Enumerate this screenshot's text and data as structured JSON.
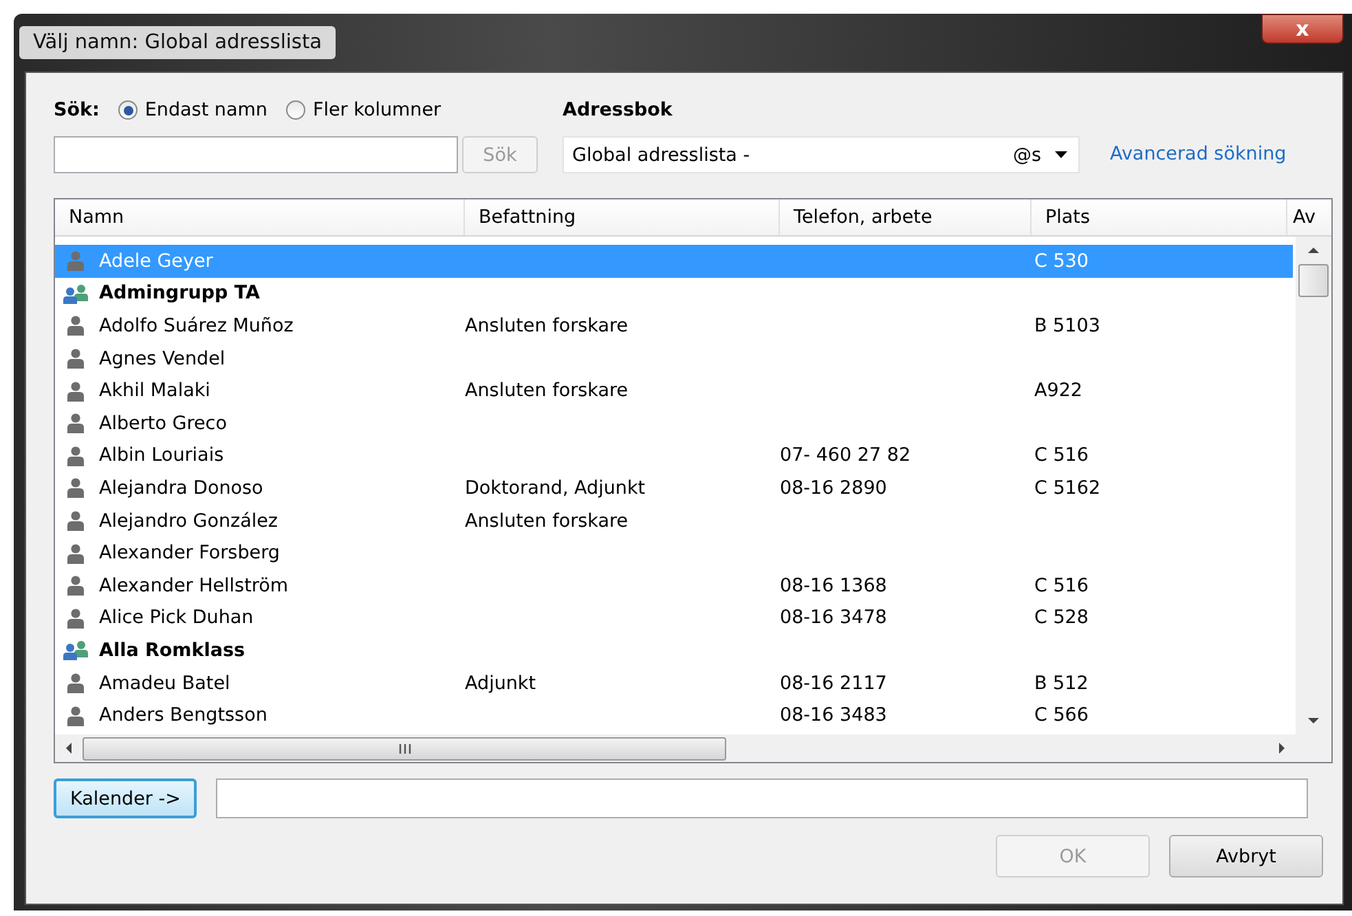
{
  "window": {
    "title": "Välj namn: Global adresslista",
    "close": "x"
  },
  "search": {
    "label": "Sök:",
    "options": [
      {
        "label": "Endast namn",
        "selected": true
      },
      {
        "label": "Fler kolumner",
        "selected": false
      }
    ],
    "button": "Sök",
    "button_disabled": true
  },
  "address_book": {
    "label": "Adressbok",
    "value": "Global adresslista -",
    "suffix": "@s",
    "advanced_link": "Avancerad sökning"
  },
  "table": {
    "columns": [
      "Namn",
      "Befattning",
      "Telefon, arbete",
      "Plats",
      "Av"
    ],
    "rows": [
      {
        "kind": "user",
        "name": "Adele Geyer",
        "title": "",
        "phone": "",
        "place": "C 530",
        "selected": true
      },
      {
        "kind": "group",
        "name": "Admingrupp TA",
        "title": "",
        "phone": "",
        "place": "",
        "selected": false
      },
      {
        "kind": "user",
        "name": "Adolfo Suárez Muñoz",
        "title": "Ansluten forskare",
        "phone": "",
        "place": "B 5103",
        "selected": false
      },
      {
        "kind": "user",
        "name": "Agnes Vendel",
        "title": "",
        "phone": "",
        "place": "",
        "selected": false
      },
      {
        "kind": "user",
        "name": "Akhil Malaki",
        "title": "Ansluten forskare",
        "phone": "",
        "place": "A922",
        "selected": false
      },
      {
        "kind": "user",
        "name": "Alberto Greco",
        "title": "",
        "phone": "",
        "place": "",
        "selected": false
      },
      {
        "kind": "user",
        "name": "Albin Louriais",
        "title": "",
        "phone": "07- 460 27 82",
        "place": "C 516",
        "selected": false
      },
      {
        "kind": "user",
        "name": "Alejandra Donoso",
        "title": "Doktorand, Adjunkt",
        "phone": "08-16 2890",
        "place": "C 5162",
        "selected": false
      },
      {
        "kind": "user",
        "name": "Alejandro González",
        "title": "Ansluten forskare",
        "phone": "",
        "place": "",
        "selected": false
      },
      {
        "kind": "user",
        "name": "Alexander Forsberg",
        "title": "",
        "phone": "",
        "place": "",
        "selected": false
      },
      {
        "kind": "user",
        "name": "Alexander Hellström",
        "title": "",
        "phone": "08-16 1368",
        "place": "C 516",
        "selected": false
      },
      {
        "kind": "user",
        "name": "Alice Pick Duhan",
        "title": "",
        "phone": "08-16 3478",
        "place": "C 528",
        "selected": false
      },
      {
        "kind": "group",
        "name": "Alla Romklass",
        "title": "",
        "phone": "",
        "place": "",
        "selected": false
      },
      {
        "kind": "user",
        "name": "Amadeu Batel",
        "title": "Adjunkt",
        "phone": "08-16 2117",
        "place": "B 512",
        "selected": false
      },
      {
        "kind": "user",
        "name": "Anders Bengtsson",
        "title": "",
        "phone": "08-16 3483",
        "place": "C 566",
        "selected": false
      }
    ]
  },
  "calendar_button": "Kalender ->",
  "buttons": [
    {
      "label": "OK",
      "disabled": true
    },
    {
      "label": "Avbryt",
      "disabled": false
    }
  ]
}
